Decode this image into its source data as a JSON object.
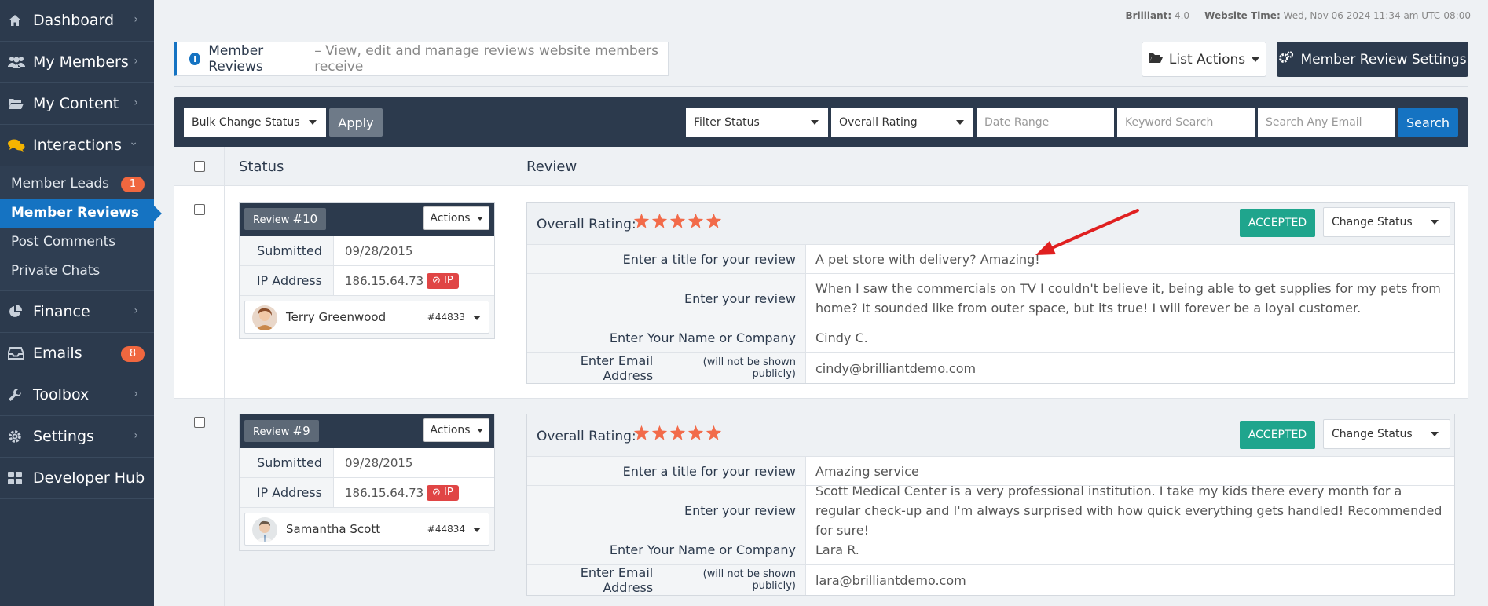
{
  "sidebar": {
    "items": [
      {
        "label": "Dashboard",
        "icon": "home-icon"
      },
      {
        "label": "My Members",
        "icon": "users-icon"
      },
      {
        "label": "My Content",
        "icon": "folder-icon"
      },
      {
        "label": "Interactions",
        "icon": "comments-icon"
      },
      {
        "label": "Finance",
        "icon": "pie-chart-icon"
      },
      {
        "label": "Emails",
        "icon": "inbox-icon",
        "badge": "8"
      },
      {
        "label": "Toolbox",
        "icon": "wrench-icon"
      },
      {
        "label": "Settings",
        "icon": "gear-icon"
      },
      {
        "label": "Developer Hub",
        "icon": "grid-icon"
      }
    ],
    "sub_items": [
      {
        "label": "Member Leads",
        "badge": "1"
      },
      {
        "label": "Member Reviews"
      },
      {
        "label": "Post Comments"
      },
      {
        "label": "Private Chats"
      }
    ]
  },
  "topinfo": {
    "version_label": "Brilliant:",
    "version": "4.0",
    "time_label": "Website Time:",
    "time": "Wed, Nov 06 2024 11:34 am UTC-08:00"
  },
  "header": {
    "title": "Member Reviews",
    "subtitle": "– View, edit and manage reviews website members receive",
    "list_actions": "List Actions",
    "settings": "Member Review Settings"
  },
  "filters": {
    "bulk": "Bulk Change Status",
    "apply": "Apply",
    "status": "Filter Status",
    "rating": "Overall Rating",
    "date_placeholder": "Date Range",
    "keyword_placeholder": "Keyword Search",
    "email_placeholder": "Search Any Email",
    "search": "Search"
  },
  "table": {
    "col_status": "Status",
    "col_review": "Review"
  },
  "labels": {
    "submitted": "Submitted",
    "ip_address": "IP Address",
    "ip_badge": "IP",
    "actions": "Actions",
    "overall_rating": "Overall Rating:",
    "accepted": "ACCEPTED",
    "change_status": "Change Status",
    "title_q": "Enter a title for your review",
    "review_q": "Enter your review",
    "name_q": "Enter Your Name or Company",
    "email_q": "Enter Email Address",
    "email_note": "(will not be shown publicly)",
    "review_word": "Review"
  },
  "reviews": [
    {
      "num": "#10",
      "submitted": "09/28/2015",
      "ip": "186.15.64.73",
      "member_name": "Terry Greenwood",
      "member_id": "#44833",
      "rating": 5,
      "title": "A pet store with delivery? Amazing!",
      "review": "When I saw the commercials on TV I couldn't believe it, being able to get supplies for my pets from home? It sounded like from outer space, but its true! I will forever be a loyal customer.",
      "name": "Cindy C.",
      "email": "cindy@brilliantdemo.com"
    },
    {
      "num": "#9",
      "submitted": "09/28/2015",
      "ip": "186.15.64.73",
      "member_name": "Samantha Scott",
      "member_id": "#44834",
      "rating": 5,
      "title": "Amazing service",
      "review": "Scott Medical Center is a very professional institution. I take my kids there every month for a regular check-up and I'm always surprised with how quick everything gets handled! Recommended for sure!",
      "name": "Lara R.",
      "email": "lara@brilliantdemo.com"
    }
  ],
  "colors": {
    "sidebar": "#2c3a4d",
    "accent": "#1573c2",
    "accepted": "#1fa58d",
    "star": "#f26b4a",
    "badge": "#f0673f"
  }
}
